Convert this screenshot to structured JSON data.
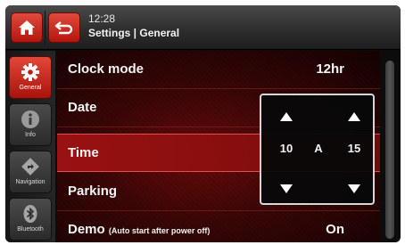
{
  "header": {
    "time": "12:28",
    "breadcrumb": "Settings | General"
  },
  "sidebar": {
    "items": [
      {
        "label": "General",
        "icon": "gear-icon",
        "active": true
      },
      {
        "label": "Info",
        "icon": "info-icon",
        "active": false
      },
      {
        "label": "Navigation",
        "icon": "navigation-icon",
        "active": false
      },
      {
        "label": "Bluetooth",
        "icon": "bluetooth-icon",
        "active": false
      }
    ]
  },
  "settings": {
    "rows": [
      {
        "label": "Clock mode",
        "value": "12hr"
      },
      {
        "label": "Date",
        "value": ""
      },
      {
        "label": "Time",
        "value": ""
      },
      {
        "label": "Parking",
        "value": ""
      },
      {
        "label": "Demo",
        "note": "(Auto start after power off)",
        "value": "On"
      }
    ]
  },
  "picker": {
    "hour": "10",
    "ampm": "A",
    "minute": "15"
  },
  "colors": {
    "accent": "#c8231a",
    "background": "#0c0c0c",
    "content_red": "#6b0a0a"
  }
}
